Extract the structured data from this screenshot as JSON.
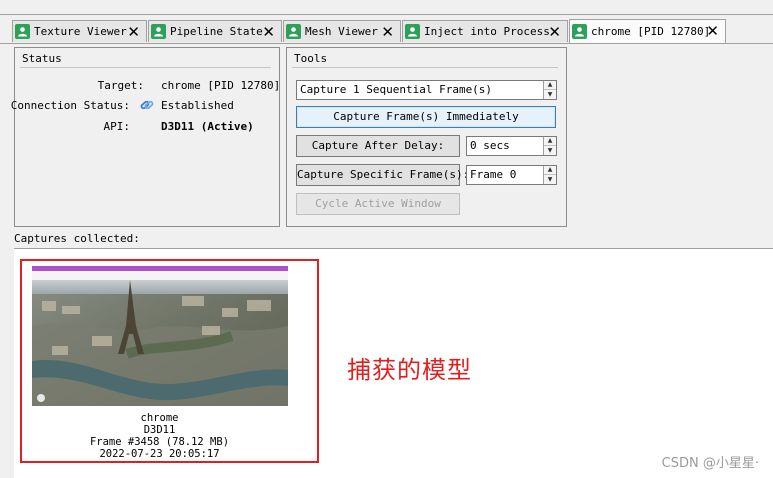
{
  "tabs": [
    {
      "label": "Texture Viewer",
      "close": "✕"
    },
    {
      "label": "Pipeline State",
      "close": "✕"
    },
    {
      "label": "Mesh Viewer",
      "close": "✕"
    },
    {
      "label": "Inject into Process",
      "close": "✕"
    },
    {
      "label": "chrome [PID 12780]",
      "close": "✕"
    }
  ],
  "status": {
    "title": "Status",
    "target_label": "Target:",
    "target_value": "chrome [PID 12780]",
    "connection_label": "Connection Status:",
    "connection_value": "Established",
    "api_label": "API:",
    "api_value": "D3D11 (Active)"
  },
  "tools": {
    "title": "Tools",
    "frames_select": "Capture 1 Sequential Frame(s)",
    "capture_now": "Capture Frame(s) Immediately",
    "capture_delay": "Capture After Delay:",
    "delay_value": "0 secs",
    "capture_specific": "Capture Specific Frame(s):",
    "frame_value": "Frame 0",
    "cycle_window": "Cycle Active Window"
  },
  "captures": {
    "label": "Captures collected:",
    "items": [
      {
        "name": "chrome",
        "api": "D3D11",
        "frame": "Frame #3458 (78.12 MB)",
        "timestamp": "2022-07-23 20:05:17"
      }
    ]
  },
  "annotation": "捕获的模型",
  "watermark": "CSDN @小星星·",
  "colors": {
    "tab_icon": "#2fa05a",
    "highlight_border": "#e02020",
    "annotation": "#e02020",
    "focus_border": "#3c7fb1"
  },
  "icons": {
    "tab": "person-icon",
    "connection": "link-icon",
    "close": "close-icon"
  }
}
